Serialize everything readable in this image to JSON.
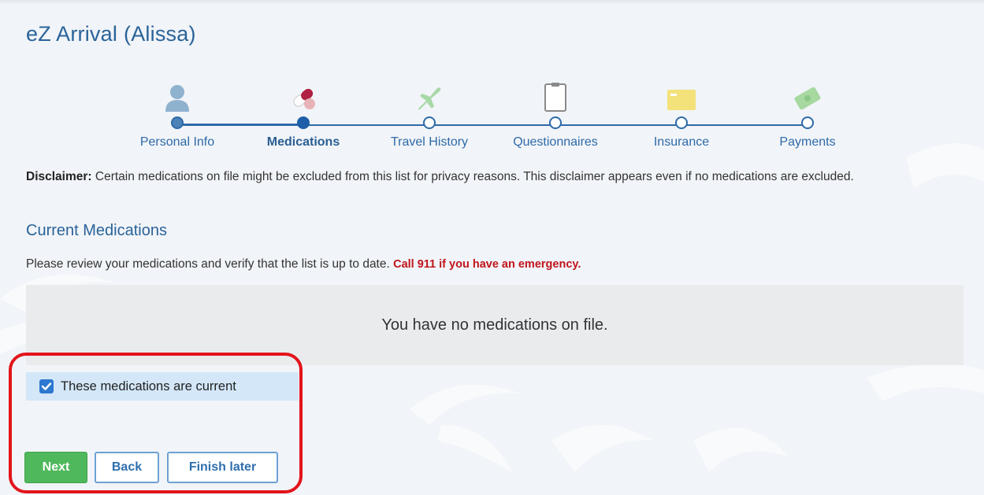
{
  "app": {
    "title": "eZ Arrival",
    "patient_name": "(Alissa)"
  },
  "steps": [
    {
      "label": "Personal Info",
      "status": "done",
      "icon": "person-icon"
    },
    {
      "label": "Medications",
      "status": "active",
      "icon": "pill-icon"
    },
    {
      "label": "Travel History",
      "status": "pending",
      "icon": "airplane-icon"
    },
    {
      "label": "Questionnaires",
      "status": "pending",
      "icon": "clipboard-icon"
    },
    {
      "label": "Insurance",
      "status": "pending",
      "icon": "insurance-card-icon"
    },
    {
      "label": "Payments",
      "status": "pending",
      "icon": "money-icon"
    }
  ],
  "disclaimer": {
    "label": "Disclaimer:",
    "text": " Certain medications on file might be excluded from this list for privacy reasons. This disclaimer appears even if no medications are excluded."
  },
  "section": {
    "title": "Current Medications",
    "instructions": "Please review your medications and verify that the list is up to date. ",
    "emergency": "Call 911 if you have an emergency.",
    "empty_message": "You have no medications on file."
  },
  "confirm": {
    "label": "These medications are current",
    "checked": true
  },
  "buttons": {
    "next": "Next",
    "back": "Back",
    "finish_later": "Finish later"
  },
  "colors": {
    "accent": "#2a6399",
    "emergency": "#c0141b",
    "next_button": "#4fb85c",
    "highlight": "#e3141b"
  }
}
